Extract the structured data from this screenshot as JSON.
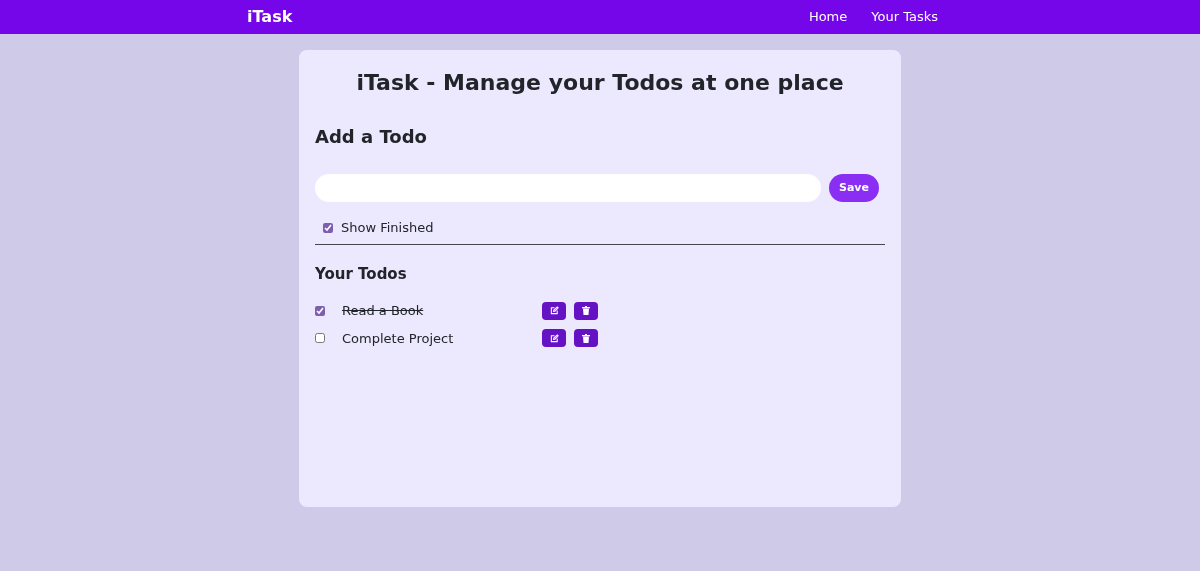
{
  "navbar": {
    "brand": "iTask",
    "links": [
      "Home",
      "Your Tasks"
    ]
  },
  "title": "iTask - Manage your Todos at one place",
  "add_section": {
    "heading": "Add a Todo",
    "save_button": "Save"
  },
  "show_finished": {
    "label": "Show Finished",
    "checked": true
  },
  "todos_heading": "Your Todos",
  "todos": [
    {
      "text": "Read a Book",
      "checked": true
    },
    {
      "text": "Complete Project",
      "checked": false
    }
  ]
}
